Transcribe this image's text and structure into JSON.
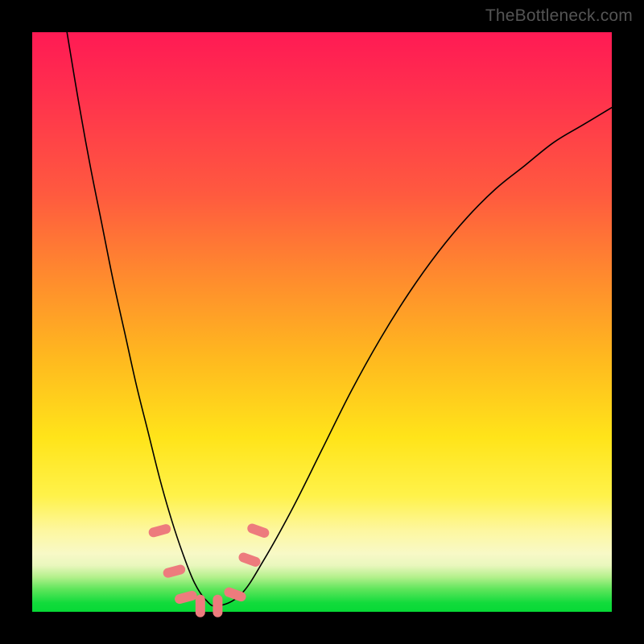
{
  "watermark": "TheBottleneck.com",
  "colors": {
    "frame_bg": "#000000",
    "marker_fill": "#ed7b7d",
    "curve_stroke": "#000000",
    "gradient_stops": [
      "#ff1a54",
      "#ff2f4e",
      "#ff5a3f",
      "#ff8a2e",
      "#ffb81f",
      "#ffe41a",
      "#fff24a",
      "#fdf7a0",
      "#f8f9c7",
      "#e9f7bd",
      "#b4f08c",
      "#62e65d",
      "#11db3b",
      "#07d936"
    ]
  },
  "chart_data": {
    "type": "line",
    "title": "",
    "xlabel": "",
    "ylabel": "",
    "xlim": [
      0,
      100
    ],
    "ylim": [
      0,
      100
    ],
    "grid": false,
    "legend": "none",
    "series": [
      {
        "name": "bottleneck-curve",
        "x": [
          6,
          8,
          10,
          12,
          14,
          16,
          18,
          20,
          22,
          24,
          26,
          28,
          30,
          32,
          36,
          40,
          45,
          50,
          55,
          60,
          65,
          70,
          75,
          80,
          85,
          90,
          95,
          100
        ],
        "values": [
          100,
          88,
          77,
          67,
          57,
          48,
          39,
          31,
          23,
          16,
          10,
          5,
          2,
          1,
          3,
          9,
          18,
          28,
          38,
          47,
          55,
          62,
          68,
          73,
          77,
          81,
          84,
          87
        ]
      }
    ],
    "markers": [
      {
        "x": 22.0,
        "y": 14.0
      },
      {
        "x": 24.5,
        "y": 7.0
      },
      {
        "x": 26.5,
        "y": 2.5
      },
      {
        "x": 29.0,
        "y": 1.0
      },
      {
        "x": 32.0,
        "y": 1.0
      },
      {
        "x": 35.0,
        "y": 3.0
      },
      {
        "x": 37.5,
        "y": 9.0
      },
      {
        "x": 39.0,
        "y": 14.0
      }
    ],
    "notes": "Curve is a V/notch shape with minimum near x≈30 at y≈0; left branch starts near top-left, right branch asymptotes toward ~87 at x=100. Values are read from the plot with no axis ticks shown; precision ±3."
  }
}
